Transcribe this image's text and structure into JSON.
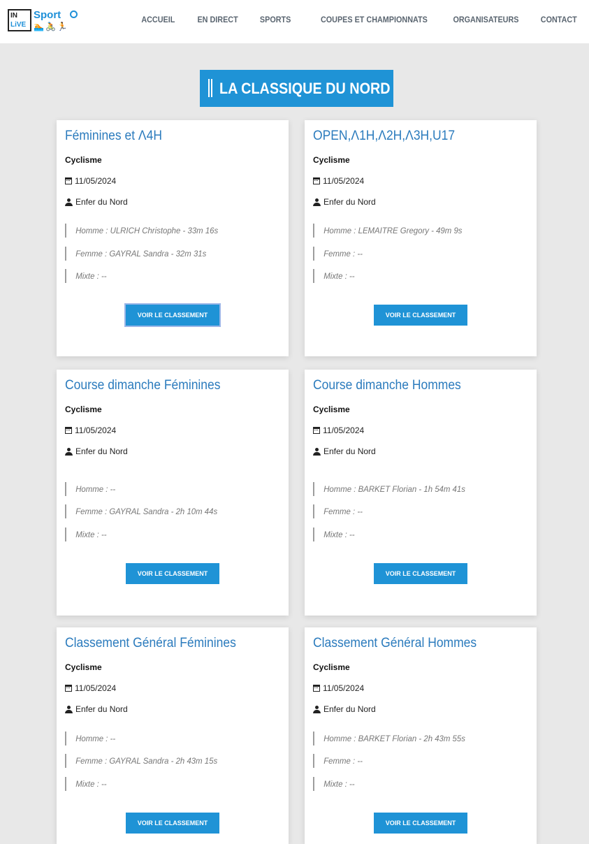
{
  "logo": {
    "line1": "IN",
    "line2": "LiVE",
    "brand": "Sport",
    "icons": "🏊🚴🏃"
  },
  "nav": [
    "ACCUEIL",
    "EN DIRECT",
    "SPORTS",
    "COUPES ET CHAMPIONNATS",
    "ORGANISATEURS",
    "CONTACT"
  ],
  "page_title": "LA CLASSIQUE DU NORD",
  "button_label": "VOIR LE CLASSEMENT",
  "cards": [
    {
      "title": "Féminines et Λ4H",
      "sport": "Cyclisme",
      "date": "11/05/2024",
      "organizer": "Enfer du Nord",
      "homme": "Homme : ULRICH Christophe - 33m 16s",
      "femme": "Femme : GAYRAL Sandra - 32m 31s",
      "mixte": "Mixte : --"
    },
    {
      "title": "OPEN,Λ1H,Λ2H,Λ3H,U17",
      "sport": "Cyclisme",
      "date": "11/05/2024",
      "organizer": "Enfer du Nord",
      "homme": "Homme : LEMAITRE Gregory - 49m 9s",
      "femme": "Femme : --",
      "mixte": "Mixte : --"
    },
    {
      "title": "Course dimanche Féminines",
      "sport": "Cyclisme",
      "date": "11/05/2024",
      "organizer": "Enfer du Nord",
      "homme": "Homme : --",
      "femme": "Femme : GAYRAL Sandra - 2h 10m 44s",
      "mixte": "Mixte : --"
    },
    {
      "title": "Course dimanche Hommes",
      "sport": "Cyclisme",
      "date": "11/05/2024",
      "organizer": "Enfer du Nord",
      "homme": "Homme : BARKET Florian - 1h 54m 41s",
      "femme": "Femme : --",
      "mixte": "Mixte : --"
    },
    {
      "title": "Classement Général Féminines",
      "sport": "Cyclisme",
      "date": "11/05/2024",
      "organizer": "Enfer du Nord",
      "homme": "Homme : --",
      "femme": "Femme : GAYRAL Sandra - 2h 43m 15s",
      "mixte": "Mixte : --"
    },
    {
      "title": "Classement Général Hommes",
      "sport": "Cyclisme",
      "date": "11/05/2024",
      "organizer": "Enfer du Nord",
      "homme": "Homme : BARKET Florian - 2h 43m 55s",
      "femme": "Femme : --",
      "mixte": "Mixte : --"
    }
  ]
}
